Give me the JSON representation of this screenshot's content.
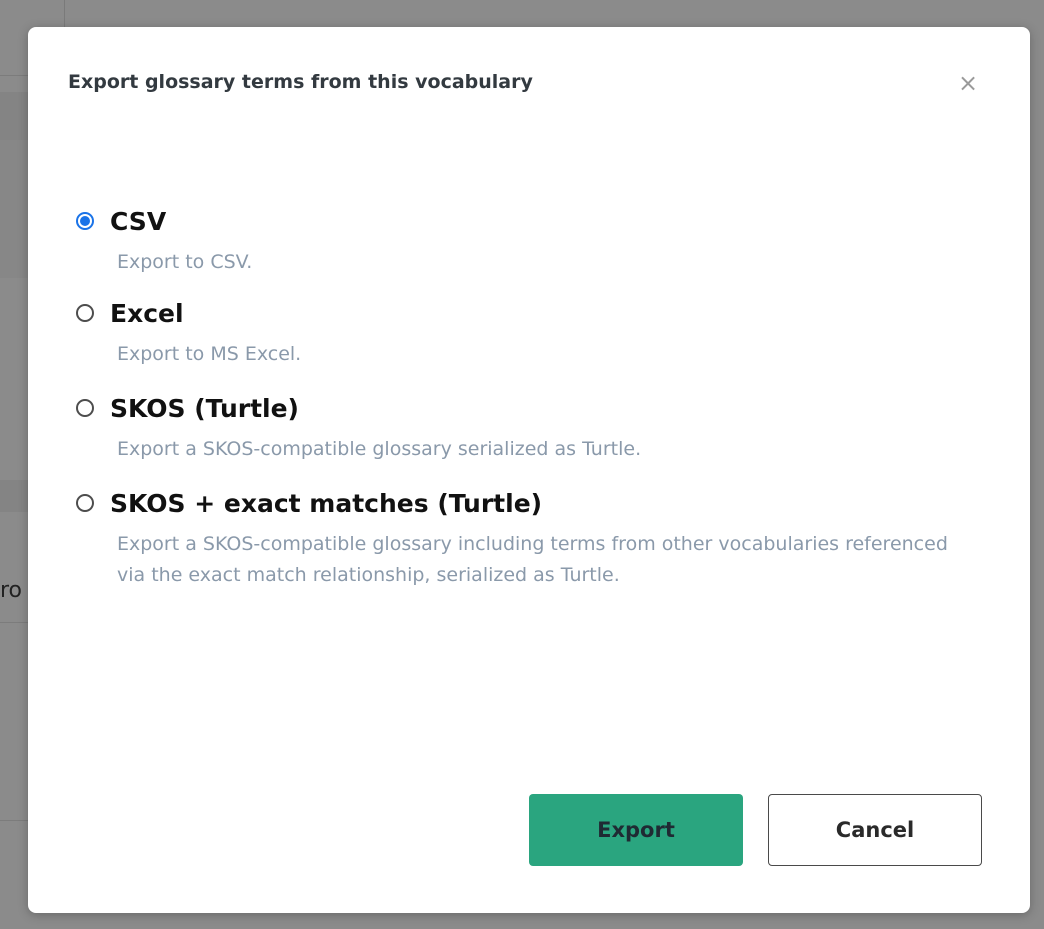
{
  "background": {
    "fragment_text": "ro"
  },
  "dialog": {
    "title": "Export glossary terms from this vocabulary",
    "close_glyph": "×",
    "options": [
      {
        "label": "CSV",
        "description": "Export to CSV.",
        "checked": true
      },
      {
        "label": "Excel",
        "description": "Export to MS Excel.",
        "checked": false
      },
      {
        "label": "SKOS (Turtle)",
        "description": "Export a SKOS-compatible glossary serialized as Turtle.",
        "checked": false
      },
      {
        "label": "SKOS + exact matches (Turtle)",
        "description": "Export a SKOS-compatible glossary including terms from other vocabularies referenced via the exact match relationship, serialized as Turtle.",
        "checked": false
      }
    ],
    "buttons": {
      "export_label": "Export",
      "cancel_label": "Cancel"
    }
  },
  "colors": {
    "accent_radio": "#1a73e8",
    "primary_button": "#2aa57f",
    "description_text": "#8a99aa"
  },
  "icons": {
    "close": "close-icon",
    "radio_checked": "radio-checked-icon",
    "radio_unchecked": "radio-unchecked-icon"
  }
}
